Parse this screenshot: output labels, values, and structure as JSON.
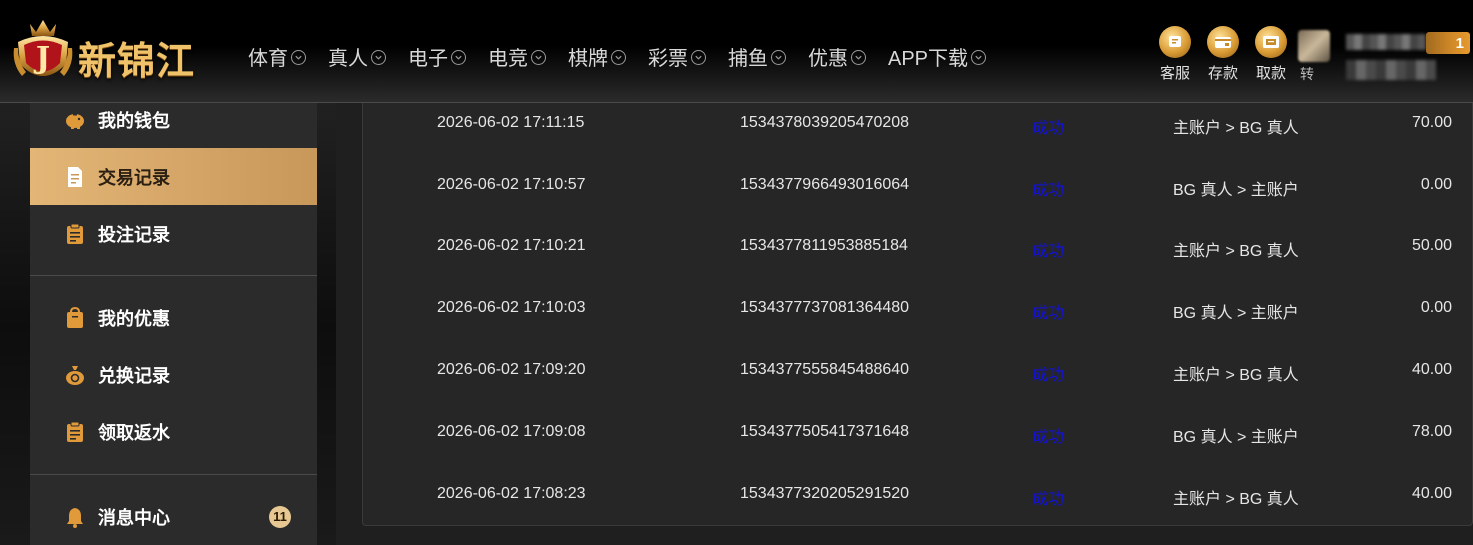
{
  "brand": {
    "name": "新锦江",
    "emblem_letter": "J"
  },
  "nav": [
    {
      "label": "体育"
    },
    {
      "label": "真人"
    },
    {
      "label": "电子"
    },
    {
      "label": "电竞"
    },
    {
      "label": "棋牌"
    },
    {
      "label": "彩票"
    },
    {
      "label": "捕鱼"
    },
    {
      "label": "优惠"
    },
    {
      "label": "APP下载"
    }
  ],
  "actions": [
    {
      "label": "客服",
      "icon": "chat-icon"
    },
    {
      "label": "存款",
      "icon": "wallet-icon"
    },
    {
      "label": "取款",
      "icon": "atm-card-icon"
    }
  ],
  "user": {
    "badge": "1",
    "partial_label": "转"
  },
  "sidebar": {
    "items": [
      {
        "label": "我的钱包",
        "icon": "piggy-bank-icon"
      },
      {
        "label": "交易记录",
        "icon": "document-icon",
        "active": true
      },
      {
        "label": "投注记录",
        "icon": "clipboard-icon"
      },
      {
        "label": "我的优惠",
        "icon": "gift-bag-icon"
      },
      {
        "label": "兑换记录",
        "icon": "money-bag-icon"
      },
      {
        "label": "领取返水",
        "icon": "clipboard-icon"
      },
      {
        "label": "消息中心",
        "icon": "bell-icon",
        "badge": "11"
      }
    ]
  },
  "transactions": [
    {
      "time": "2026-06-02 17:11:15",
      "id": "1534378039205470208",
      "status": "成功",
      "transfer": "主账户 > BG 真人",
      "amount": "70.00"
    },
    {
      "time": "2026-06-02 17:10:57",
      "id": "1534377966493016064",
      "status": "成功",
      "transfer": "BG 真人 > 主账户",
      "amount": "0.00"
    },
    {
      "time": "2026-06-02 17:10:21",
      "id": "1534377811953885184",
      "status": "成功",
      "transfer": "主账户 > BG 真人",
      "amount": "50.00"
    },
    {
      "time": "2026-06-02 17:10:03",
      "id": "1534377737081364480",
      "status": "成功",
      "transfer": "BG 真人 > 主账户",
      "amount": "0.00"
    },
    {
      "time": "2026-06-02 17:09:20",
      "id": "1534377555845488640",
      "status": "成功",
      "transfer": "主账户 > BG 真人",
      "amount": "40.00"
    },
    {
      "time": "2026-06-02 17:09:08",
      "id": "1534377505417371648",
      "status": "成功",
      "transfer": "BG 真人 > 主账户",
      "amount": "78.00"
    },
    {
      "time": "2026-06-02 17:08:23",
      "id": "1534377320205291520",
      "status": "成功",
      "transfer": "主账户 > BG 真人",
      "amount": "40.00"
    }
  ],
  "colors": {
    "accent_gold": "#e3b676",
    "status_blue": "#1212d8",
    "badge_orange": "#d28a28"
  }
}
